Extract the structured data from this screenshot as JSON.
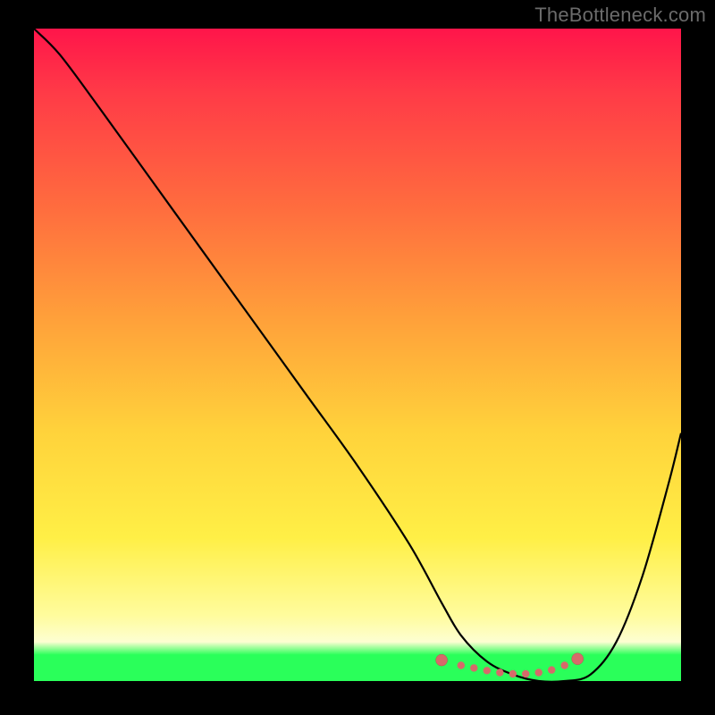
{
  "watermark": "TheBottleneck.com",
  "colors": {
    "background": "#000000",
    "gradient_top": "#ff154a",
    "gradient_mid1": "#ff6e3e",
    "gradient_mid2": "#ffd33b",
    "gradient_low": "#fffc9d",
    "gradient_green": "#2aff5a",
    "curve": "#000000",
    "dots": "#d66a6a"
  },
  "chart_data": {
    "type": "line",
    "title": "",
    "xlabel": "",
    "ylabel": "",
    "xlim": [
      0,
      100
    ],
    "ylim": [
      0,
      100
    ],
    "series": [
      {
        "name": "bottleneck-curve",
        "x": [
          0,
          4,
          10,
          18,
          26,
          34,
          42,
          50,
          58,
          63,
          66,
          70,
          74,
          78,
          82,
          86,
          90,
          94,
          98,
          100
        ],
        "y": [
          100,
          96,
          88,
          77,
          66,
          55,
          44,
          33,
          21,
          12,
          7,
          3,
          1,
          0,
          0,
          1,
          6,
          16,
          30,
          38
        ]
      }
    ],
    "markers": {
      "name": "highlight-dots",
      "x": [
        63,
        66,
        68,
        70,
        72,
        74,
        76,
        78,
        80,
        82,
        84
      ],
      "y": [
        3.2,
        2.4,
        2.0,
        1.6,
        1.3,
        1.1,
        1.1,
        1.3,
        1.7,
        2.4,
        3.4
      ]
    },
    "annotations": []
  }
}
